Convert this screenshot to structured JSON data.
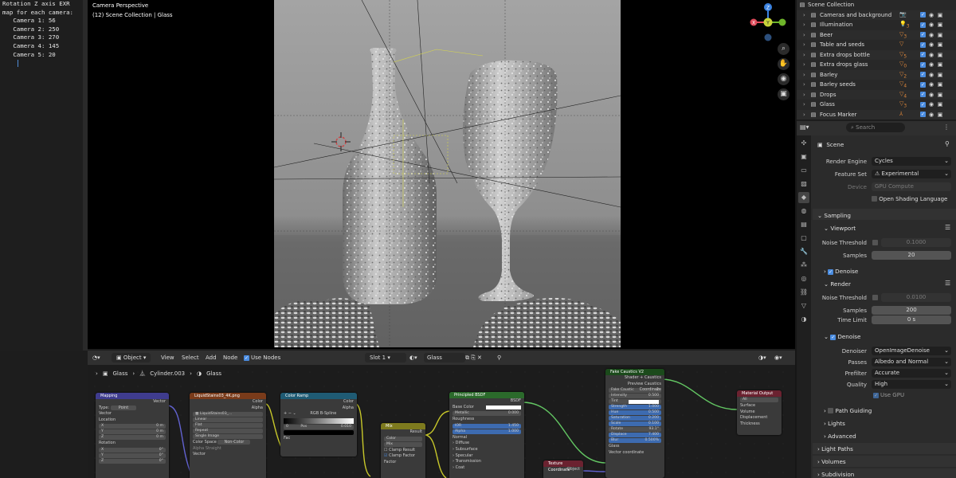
{
  "text_editor": {
    "lines": [
      "Rotation Z axis EXR",
      "map for each camera:",
      "   Camera 1: 56",
      "   Camera 2: 250",
      "   Camera 3: 270",
      "   Camera 4: 145",
      "   Camera 5: 20"
    ]
  },
  "viewport": {
    "mode": "Camera Perspective",
    "collection": "(12) Scene Collection | Glass"
  },
  "gizmo": {
    "x": "X",
    "y": "Y",
    "z": "Z"
  },
  "outliner": {
    "title": "Scene Collection",
    "rows": [
      {
        "name": "Cameras and background",
        "icon": "camera-icon",
        "badge": ""
      },
      {
        "name": "Illumination",
        "icon": "light-icon",
        "badge": "3"
      },
      {
        "name": "Beer",
        "icon": "cone-icon",
        "badge": "3"
      },
      {
        "name": "Table and seeds",
        "icon": "cone-icon",
        "badge": ""
      },
      {
        "name": "Extra drops bottle",
        "icon": "cone-icon",
        "badge": "5"
      },
      {
        "name": "Extra drops glass",
        "icon": "cone-icon",
        "badge": "0"
      },
      {
        "name": "Barley",
        "icon": "cone-icon",
        "badge": "2"
      },
      {
        "name": "Barley seeds",
        "icon": "cone-icon",
        "badge": "4"
      },
      {
        "name": "Drops",
        "icon": "cone-icon",
        "badge": "4"
      },
      {
        "name": "Glass",
        "icon": "cone-icon",
        "badge": "3"
      },
      {
        "name": "Focus Marker",
        "icon": "empty-icon",
        "badge": ""
      }
    ]
  },
  "properties": {
    "search_placeholder": "Search",
    "scene": "Scene",
    "render_engine_label": "Render Engine",
    "render_engine": "Cycles",
    "feature_set_label": "Feature Set",
    "feature_set": "Experimental",
    "device_label": "Device",
    "device": "GPU Compute",
    "osl": "Open Shading Language",
    "sampling": "Sampling",
    "viewport": "Viewport",
    "noise_threshold_label": "Noise Threshold",
    "vp_noise": "0.1000",
    "samples_label": "Samples",
    "vp_samples": "20",
    "denoise": "Denoise",
    "render": "Render",
    "r_noise": "0.0100",
    "r_samples": "200",
    "time_limit_label": "Time Limit",
    "time_limit": "0 s",
    "denoiser_label": "Denoiser",
    "denoiser": "OpenImageDenoise",
    "passes_label": "Passes",
    "passes": "Albedo and Normal",
    "prefilter_label": "Prefilter",
    "prefilter": "Accurate",
    "quality_label": "Quality",
    "quality": "High",
    "use_gpu": "Use GPU",
    "path_guiding": "Path Guiding",
    "lights": "Lights",
    "advanced": "Advanced",
    "light_paths": "Light Paths",
    "volumes": "Volumes",
    "subdivision": "Subdivision"
  },
  "node_editor": {
    "editor": "Object",
    "menus": [
      "View",
      "Select",
      "Add",
      "Node"
    ],
    "use_nodes": "Use Nodes",
    "slot": "Slot 1",
    "material": "Glass",
    "breadcrumb": [
      "Glass",
      "Cylinder.003",
      "Glass"
    ],
    "nodes": {
      "mapping": {
        "title": "Mapping",
        "vector": "Vector",
        "type_label": "Type:",
        "type": "Point",
        "in_vector": "Vector",
        "location": "Location",
        "rotation": "Rotation",
        "x": "X",
        "y": "Y",
        "z": "Z",
        "loc": "0 m",
        "rot": "0°"
      },
      "image": {
        "title": "LiquidStains03_4K.png",
        "file": "LiquidStains03_...",
        "color": "Color",
        "alpha": "Alpha",
        "interp": "Linear",
        "proj": "Flat",
        "ext": "Repeat",
        "src": "Single Image",
        "cs_label": "Color Space",
        "cs": "Non-Color",
        "alpha_label": "Alpha",
        "alpha_mode": "Straight",
        "vector": "Vector"
      },
      "ramp": {
        "title": "Color Ramp",
        "color": "Color",
        "alpha": "Alpha",
        "mode": "RGB",
        "interp": "B-Spline",
        "pos0": "0",
        "pos_label": "Pos",
        "pos": "0.010",
        "fac": "Fac"
      },
      "mix": {
        "title": "Mix",
        "result": "Result",
        "type": "Color",
        "blend": "Mix",
        "clamp_result": "Clamp Result",
        "clamp_factor": "Clamp Factor",
        "factor": "Factor"
      },
      "bsdf": {
        "title": "Principled BSDF",
        "bsdf": "BSDF",
        "base": "Base Color",
        "metallic": "Metallic",
        "metallic_v": "0.000",
        "roughness": "Roughness",
        "ior": "IOR",
        "ior_v": "1.450",
        "alpha": "Alpha",
        "alpha_v": "1.000",
        "normal": "Normal",
        "sub": [
          "Diffuse",
          "Subsurface",
          "Specular",
          "Transmission",
          "Coat"
        ]
      },
      "caustics": {
        "title": "Fake Caustics V2",
        "shader": "Shader + Caustics",
        "preview": "Preview Caustics Coordinate",
        "group": "Fake Caustic",
        "users": "2",
        "intensity": "Intensity",
        "intensity_v": "0.500",
        "tint": "Tint",
        "strength": "Strength",
        "strength_v": "1.000",
        "hue": "Hue",
        "hue_v": "0.500",
        "saturation": "Saturation",
        "saturation_v": "0.200",
        "scale": "Scale",
        "scale_v": "0.100",
        "rotate": "Rotate",
        "rotate_v": "93.1°",
        "displace": "Displace",
        "displace_v": "7.400",
        "blur": "Blur",
        "blur_v": "0.500%",
        "glass": "Glass",
        "vec": "Vector coordinate"
      },
      "output": {
        "title": "Material Output",
        "target": "All",
        "surface": "Surface",
        "volume": "Volume",
        "displacement": "Displacement",
        "thickness": "Thickness"
      },
      "texcoord": {
        "title": "Texture Coordinate",
        "object": "Object"
      }
    }
  },
  "colors": {
    "accent": "#4a8ce0",
    "orange": "#e0883a",
    "node_vector": "#3f3c8e",
    "node_texture": "#7a3b1a",
    "node_convert": "#1f5b74",
    "node_shader": "#2b6a2b",
    "node_color": "#7d7a1e",
    "node_group": "#1b4a1b",
    "node_output": "#6b2230",
    "wire_green": "#63c763",
    "wire_purple": "#6262d0",
    "wire_yellow": "#c7c72a"
  }
}
